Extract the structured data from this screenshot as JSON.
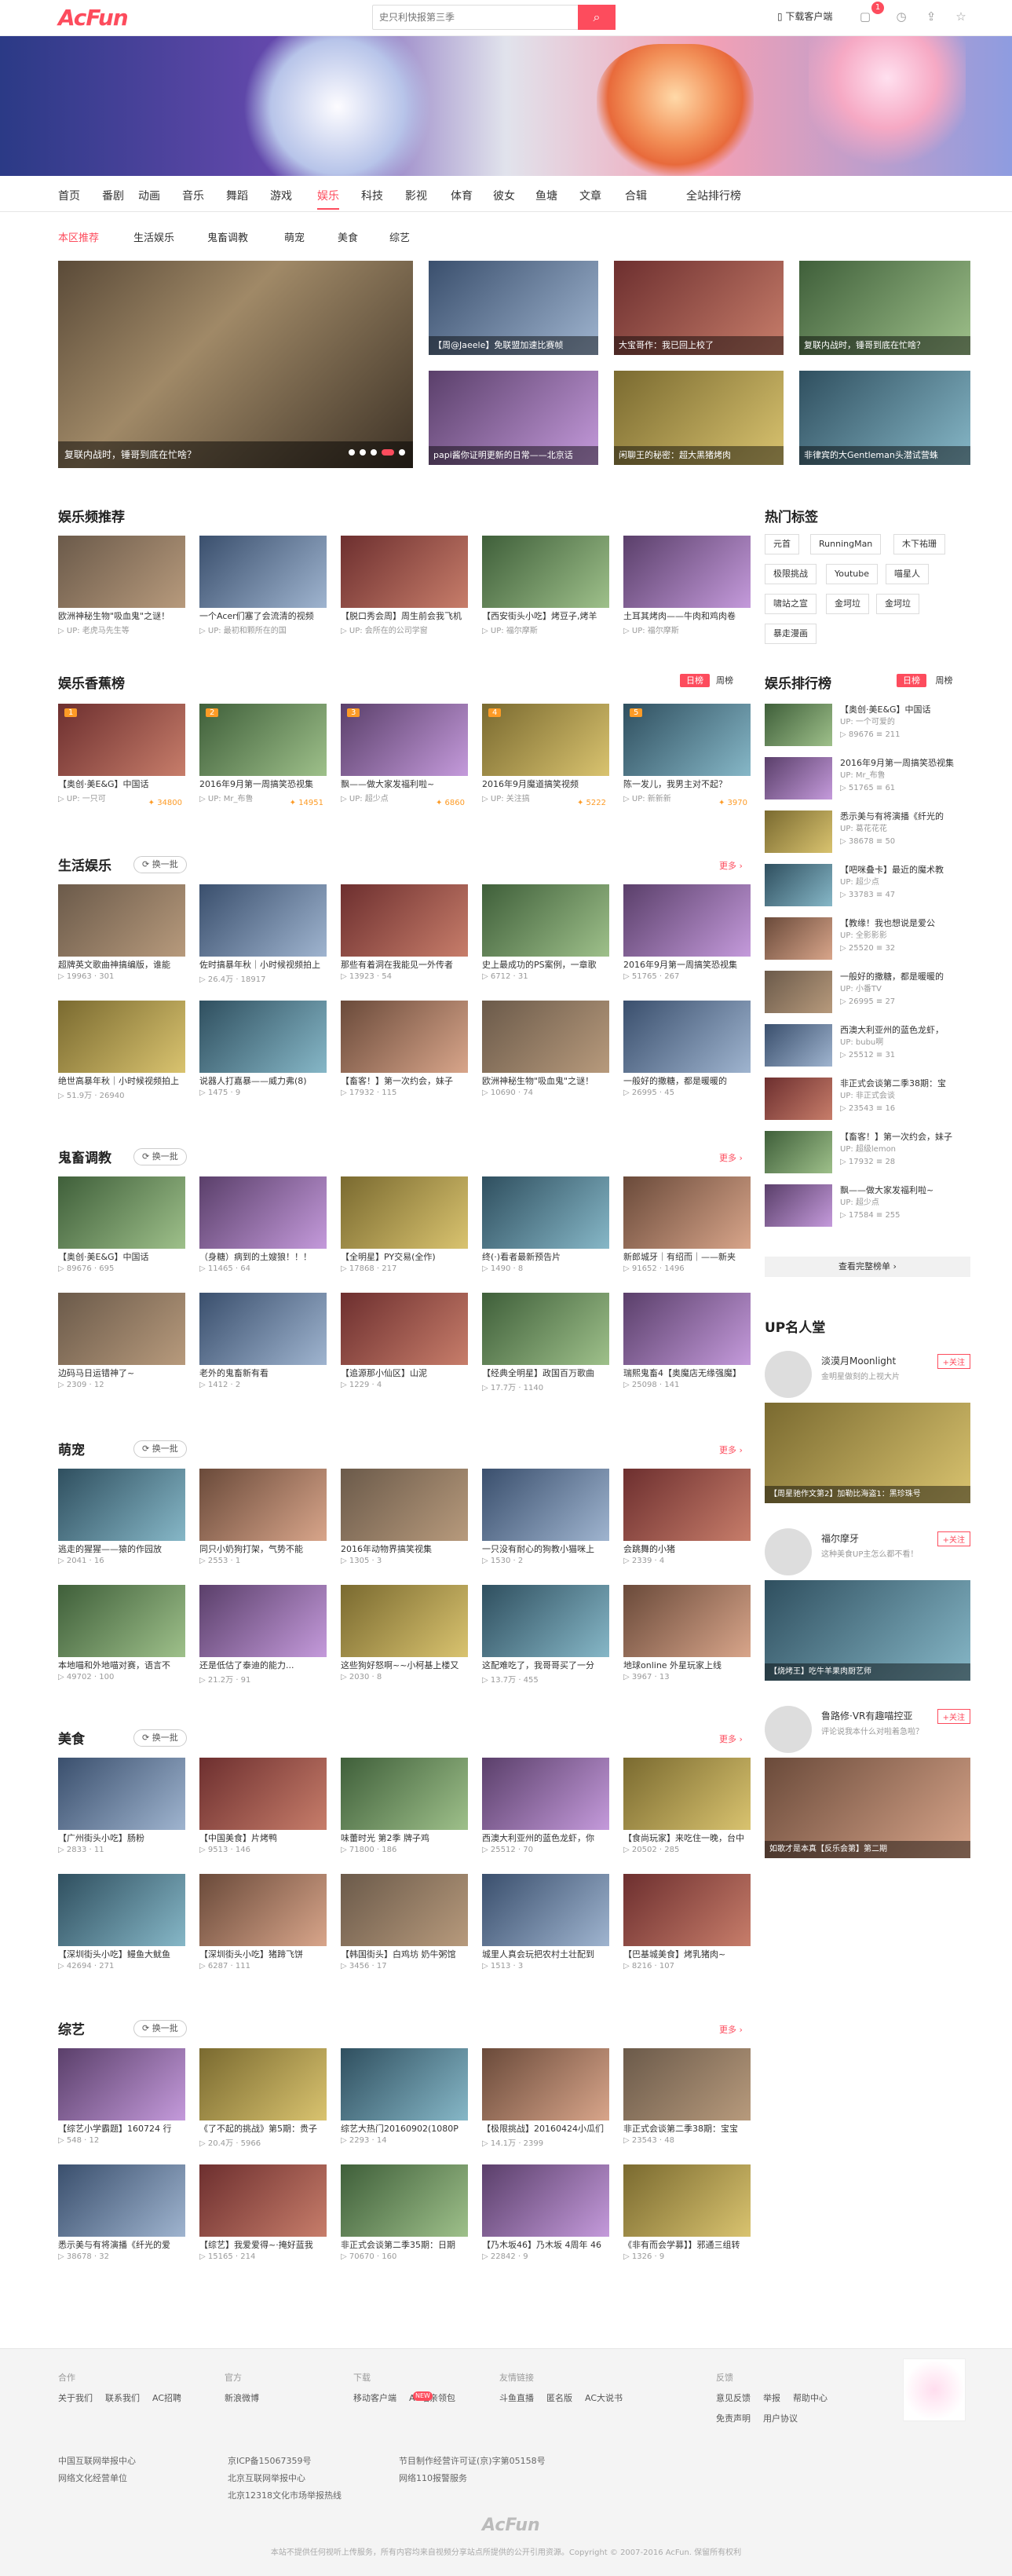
{
  "header": {
    "logo": "AcFun",
    "search_placeholder": "史只利快报第三季",
    "download": "下载客户端",
    "msg_count": "1"
  },
  "nav": [
    "首页",
    "番剧",
    "动画",
    "音乐",
    "舞蹈",
    "游戏",
    "娱乐",
    "科技",
    "影视",
    "体育",
    "彼女",
    "鱼塘",
    "文章",
    "合辑",
    "全站排行榜"
  ],
  "subnav": [
    "本区推荐",
    "生活娱乐",
    "鬼畜调教",
    "萌宠",
    "美食",
    "综艺"
  ],
  "hero": {
    "caption": "复联内战时，锤哥到底在忙啥？"
  },
  "tiles": [
    "【周@Jaeele】免联盟加速比赛帧",
    "大宝哥作：我已回上校了",
    "复联内战时，锤哥到底在忙啥？",
    "papi酱你证明更新的日常——北京话",
    "闲聊王的秘密：超大黑猪烤肉",
    "非律宾的大Gentleman头潜试营蛛"
  ],
  "rec": {
    "title": "娱乐频推荐",
    "cards": [
      {
        "t": "欧洲神秘生物\"吸血鬼\"之谜！",
        "m": "UP: 老虎马先生等"
      },
      {
        "t": "一个Acer们塞了会流清的视频",
        "m": "UP: 最初和颗所在的国"
      },
      {
        "t": "【脱口秀会周】周生前会我飞机",
        "m": "UP: 会所在的公司学窗"
      },
      {
        "t": "【西安街头小吃】烤豆子,烤羊",
        "m": "UP: 福尔摩斯"
      },
      {
        "t": "土耳其烤肉——牛肉和鸡肉卷",
        "m": "UP: 福尔摩斯"
      }
    ]
  },
  "hot_tags": {
    "title": "热门标签",
    "tags": [
      "元首",
      "RunningMan",
      "木下祐珊",
      "极限挑战",
      "Youtube",
      "喵星人",
      "啸站之宣",
      "金坷垃",
      "金坷垃",
      "暴走漫画"
    ]
  },
  "rank": {
    "title": "娱乐香蕉榜",
    "tab_day": "日榜",
    "tab_week": "周榜",
    "cards": [
      {
        "t": "【奥创·美E&G】中国话",
        "m": "UP: 一只可",
        "v": "34800",
        "r": "1"
      },
      {
        "t": "2016年9月第一周搞笑恐视集",
        "m": "UP: Mr_布鲁",
        "v": "14951",
        "r": "2"
      },
      {
        "t": "飘——做大家发福利啦~",
        "m": "UP: 超少点",
        "v": "6860",
        "r": "3"
      },
      {
        "t": "2016年9月魔道搞笑视频",
        "m": "UP: 关注搞",
        "v": "5222",
        "r": "4"
      },
      {
        "t": "陈一发儿，我男主对不起？",
        "m": "UP: 新新新",
        "v": "3970",
        "r": "5"
      }
    ]
  },
  "sections": [
    {
      "title": "生活娱乐",
      "refresh": "换一批",
      "more": "更多",
      "cards": [
        {
          "t": "超牌英文歌曲神搞编版，谁能",
          "m": "19963 · 301"
        },
        {
          "t": "佐时搞暴年秋｜小时候视频拍上",
          "m": "26.4万 · 18917"
        },
        {
          "t": "那些有着洞在我能见一外传者",
          "m": "13923 · 54"
        },
        {
          "t": "史上最成功的PS案例，一章歌",
          "m": "6712 · 31"
        },
        {
          "t": "2016年9月第一周搞笑恐视集",
          "m": "51765 · 267"
        },
        {
          "t": "绝世高暴年秋｜小时候视频拍上",
          "m": "51.9万 · 26940"
        },
        {
          "t": "说器人打嘉暴——威力弗(8)",
          "m": "1475 · 9"
        },
        {
          "t": "【畜客！】第一次约会，妹子",
          "m": "17932 · 115"
        },
        {
          "t": "欧洲神秘生物\"吸血鬼\"之谜！",
          "m": "10690 · 74"
        },
        {
          "t": "一般好的撒糖，都是暖暖的",
          "m": "26995 · 45"
        }
      ]
    },
    {
      "title": "鬼畜调教",
      "refresh": "换一批",
      "more": "更多",
      "cards": [
        {
          "t": "【奥创·美E&G】中国话",
          "m": "89676 · 695"
        },
        {
          "t": "（身糖）病到的土嫂狼！！！",
          "m": "11465 · 64"
        },
        {
          "t": "【全明星】PY交易(全作)",
          "m": "17868 · 217"
        },
        {
          "t": "终(·)看者最新预告片",
          "m": "1490 · 8"
        },
        {
          "t": "新郎城牙｜有绍而｜——新夹",
          "m": "91652 · 1496"
        },
        {
          "t": "边码马日运错神了~",
          "m": "2309 · 12"
        },
        {
          "t": "老外的鬼畜新有看",
          "m": "1412 · 2"
        },
        {
          "t": "【追源那小仙区】山泥",
          "m": "1229 · 4"
        },
        {
          "t": "【经典全明星】政国百万歌曲",
          "m": "17.7万 · 1140"
        },
        {
          "t": "瑞熙鬼畜4【奥魔店无缘强魔】",
          "m": "25098 · 141"
        }
      ]
    },
    {
      "title": "萌宠",
      "refresh": "换一批",
      "more": "更多",
      "cards": [
        {
          "t": "逃走的猩猩——猿的作园放",
          "m": "2041 · 16"
        },
        {
          "t": "同只小奶狗打架，气势不能",
          "m": "2553 · 1"
        },
        {
          "t": "2016年动物界搞笑视集",
          "m": "1305 · 3"
        },
        {
          "t": "一只没有耐心的狗教小猫咪上",
          "m": "1530 · 2"
        },
        {
          "t": "会跳舞的小猪",
          "m": "2339 · 4"
        },
        {
          "t": "本地喵和外地喵对赛，语言不",
          "m": "49702 · 100"
        },
        {
          "t": "还是低估了泰迪的能力...",
          "m": "21.2万 · 91"
        },
        {
          "t": "这些狗好怒啊~~小柯基上楼又",
          "m": "2030 · 8"
        },
        {
          "t": "这配难吃了，我哥哥买了一分",
          "m": "13.7万 · 455"
        },
        {
          "t": "地球online 外星玩家上线",
          "m": "3967 · 13"
        }
      ]
    },
    {
      "title": "美食",
      "refresh": "换一批",
      "more": "更多",
      "cards": [
        {
          "t": "【广州街头小吃】肠粉",
          "m": "2833 · 11"
        },
        {
          "t": "【中国美食】片烤鸭",
          "m": "9513 · 146"
        },
        {
          "t": "味蕾时光 第2季 牌子鸡",
          "m": "71800 · 186"
        },
        {
          "t": "西澳大利亚州的蓝色龙虾，你",
          "m": "25512 · 70"
        },
        {
          "t": "【食尚玩家】来吃住一晚，台中",
          "m": "20502 · 285"
        },
        {
          "t": "【深圳街头小吃】鳗鱼大鱿鱼",
          "m": "42694 · 271"
        },
        {
          "t": "【深圳街头小吃】猪蹄飞饼",
          "m": "6287 · 111"
        },
        {
          "t": "【韩国街头】白鸡坊 奶牛粥馆",
          "m": "3456 · 17"
        },
        {
          "t": "城里人真会玩把农村土壮配到",
          "m": "1513 · 3"
        },
        {
          "t": "【巴基城美食】烤乳猪肉~",
          "m": "8216 · 107"
        }
      ]
    },
    {
      "title": "综艺",
      "refresh": "换一批",
      "more": "更多",
      "cards": [
        {
          "t": "【综艺小学霸题】160724 行",
          "m": "548 · 12"
        },
        {
          "t": "《了不起的挑战》第5期：贵子",
          "m": "20.4万 · 5966"
        },
        {
          "t": "综艺大热门20160902(1080P",
          "m": "2293 · 14"
        },
        {
          "t": "【极限挑战】20160424小瓜们",
          "m": "14.1万 · 2399"
        },
        {
          "t": "非正式会谈第二季38期：宝宝",
          "m": "23543 · 48"
        },
        {
          "t": "悉示美与有将演播《纤光的爱",
          "m": "38678 · 32"
        },
        {
          "t": "【综艺】我爱爱得~·掩好蓝我",
          "m": "15165 · 214"
        },
        {
          "t": "非正式会谈第二季35期：日期",
          "m": "70670 · 160"
        },
        {
          "t": "【乃木坂46】乃木坂 4周年 46",
          "m": "22842 · 9"
        },
        {
          "t": "《非有而会学募】】邪通三组转",
          "m": "1326 · 9"
        }
      ]
    }
  ],
  "right_rank": {
    "title": "娱乐排行榜",
    "tab_day": "日榜",
    "tab_week": "周榜",
    "more": "查看完整榜单",
    "items": [
      {
        "t": "【奥创·美E&G】中国话",
        "u": "UP: 一个可爱的",
        "v": "89676",
        "c": "211"
      },
      {
        "t": "2016年9月第一周搞笑恐视集",
        "u": "UP: Mr_布鲁",
        "v": "51765",
        "c": "61"
      },
      {
        "t": "悉示美与有将演播《纤光的",
        "u": "UP: 葛花花花",
        "v": "38678",
        "c": "50"
      },
      {
        "t": "【吧咪叠卡】最近的魔术教",
        "u": "UP: 超少点",
        "v": "33783",
        "c": "47"
      },
      {
        "t": "【教缘！我也想说是爱公",
        "u": "UP: 全影影影",
        "v": "25520",
        "c": "32"
      },
      {
        "t": "一般好的撒糖，都是暖暖的",
        "u": "UP: 小番TV",
        "v": "26995",
        "c": "27"
      },
      {
        "t": "西澳大利亚州的蓝色龙虾，",
        "u": "UP: bubu啊",
        "v": "25512",
        "c": "31"
      },
      {
        "t": "非正式会谈第二季38期：宝",
        "u": "UP: 非正式会谈",
        "v": "23543",
        "c": "16"
      },
      {
        "t": "【畜客！】第一次约会，妹子",
        "u": "UP: 超级lemon",
        "v": "17932",
        "c": "28"
      },
      {
        "t": "飘——做大家发福利啦~",
        "u": "UP: 超少点",
        "v": "17584",
        "c": "255"
      }
    ]
  },
  "upmasters": {
    "title": "UP名人堂",
    "follow": "+关注",
    "items": [
      {
        "n": "淡漠月Moonlight",
        "d": "金明星做刻的上视大片",
        "cap": "【周星驰作文第2】加勒比海盗1：黑珍珠号"
      },
      {
        "n": "福尔摩牙",
        "d": "这种美食UP主怎么都不看！",
        "cap": "【烧烤王】吃牛羊果肉厨艺师"
      },
      {
        "n": "鲁路修·VR有趣喵控亚",
        "d": "评论说我本什么对啦着急啦？",
        "cap": "如歌才是本真【反乐会第】第二期"
      }
    ]
  },
  "footer": {
    "cols": [
      {
        "h": "合作",
        "items": [
          "关于我们",
          "联系我们",
          "AC招聘"
        ]
      },
      {
        "h": "官方",
        "items": [
          "新浪微博"
        ]
      },
      {
        "h": "下载",
        "items": [
          "移动客户端",
          "AC喵亲领包"
        ],
        "new": "NEW"
      },
      {
        "h": "友情链接",
        "items": [
          "斗鱼直播",
          "匿名版",
          "AC大说书"
        ]
      },
      {
        "h": "反馈",
        "items": [
          "意见反馈",
          "举报",
          "帮助中心",
          "免责声明",
          "用户协议"
        ]
      }
    ],
    "lic1": "中国互联网举报中心",
    "lic2": "网络文化经营单位",
    "lic3": "京ICP备15067359号",
    "lic4": "北京互联网举报中心",
    "lic5": "北京12318文化市场举报热线",
    "lic6": "节目制作经营许可证(京)字第05158号",
    "lic7": "网络110报警服务",
    "logo": "AcFun",
    "copy": "本站不提供任何视听上传服务，所有内容均来自视频分享站点所提供的公开引用资源。Copyright © 2007-2016 AcFun. 保留所有权利"
  }
}
